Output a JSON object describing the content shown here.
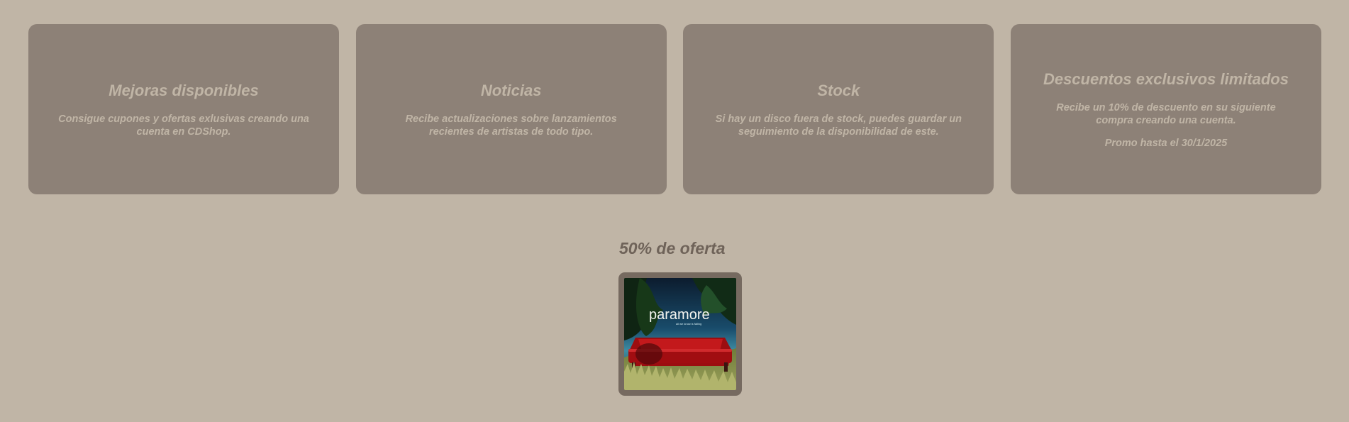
{
  "cards": [
    {
      "title": "Mejoras disponibles",
      "text": "Consigue cupones y ofertas exlusivas creando una cuenta en CDShop."
    },
    {
      "title": "Noticias",
      "text": "Recibe actualizaciones sobre lanzamientos recientes de artistas de todo tipo."
    },
    {
      "title": "Stock",
      "text": "Si hay un disco fuera de stock, puedes guardar un seguimiento de la disponibilidad de este."
    },
    {
      "title": "Descuentos exclusivos limitados",
      "text": "Recibe un 10% de descuento en su siguiente compra creando una cuenta.",
      "extra": "Promo hasta el 30/1/2025"
    }
  ],
  "offer": {
    "title": "50% de oferta",
    "album": {
      "artist_text": "paramore",
      "subtitle_text": "all we know is falling"
    }
  },
  "colors": {
    "background": "#c0b5a6",
    "card": "#8d8177",
    "card_text": "#c0b5a6",
    "offer_title": "#6f6359",
    "album_frame": "#766a60"
  }
}
